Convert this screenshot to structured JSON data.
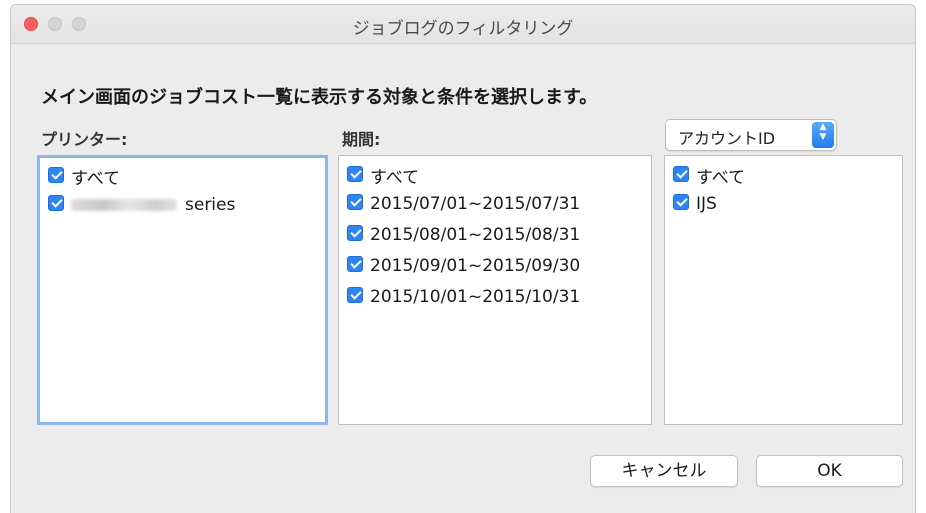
{
  "window": {
    "title": "ジョブログのフィルタリング"
  },
  "instruction": "メイン画面のジョブコスト一覧に表示する対象と条件を選択します。",
  "printers": {
    "label": "プリンター:",
    "items": [
      {
        "label": "すべて",
        "checked": true
      },
      {
        "label": "series",
        "checked": true,
        "name_redacted": true
      }
    ]
  },
  "periods": {
    "label": "期間:",
    "items": [
      {
        "label": "すべて",
        "checked": true
      },
      {
        "label": "2015/07/01~2015/07/31",
        "checked": true
      },
      {
        "label": "2015/08/01~2015/08/31",
        "checked": true
      },
      {
        "label": "2015/09/01~2015/09/30",
        "checked": true
      },
      {
        "label": "2015/10/01~2015/10/31",
        "checked": true
      }
    ]
  },
  "accounts": {
    "selector_value": "アカウントID",
    "items": [
      {
        "label": "すべて",
        "checked": true
      },
      {
        "label": "IJS",
        "checked": true
      }
    ]
  },
  "buttons": {
    "cancel": "キャンセル",
    "ok": "OK"
  },
  "colors": {
    "checkbox": "#2f83f3",
    "focus_ring": "#8fb7ea",
    "close_button": "#fc605c"
  }
}
